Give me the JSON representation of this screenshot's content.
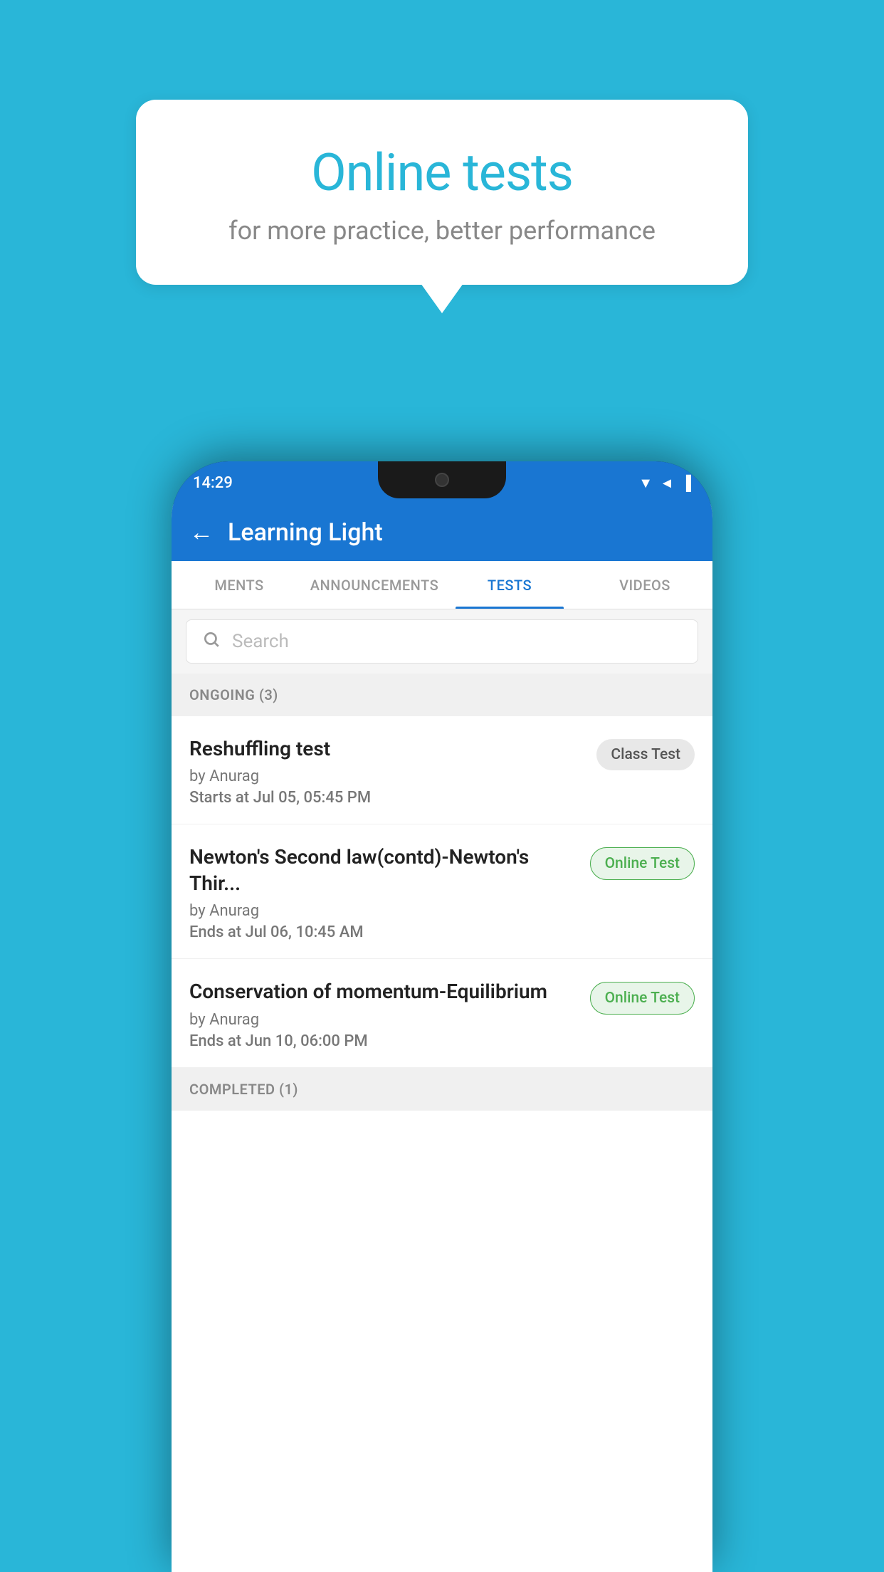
{
  "background": {
    "color": "#29b6d8"
  },
  "speech_bubble": {
    "title": "Online tests",
    "subtitle": "for more practice, better performance"
  },
  "phone": {
    "status_bar": {
      "time": "14:29",
      "icons": "▼◄▐"
    },
    "app_bar": {
      "back_label": "←",
      "title": "Learning Light"
    },
    "tabs": [
      {
        "label": "MENTS",
        "active": false
      },
      {
        "label": "ANNOUNCEMENTS",
        "active": false
      },
      {
        "label": "TESTS",
        "active": true
      },
      {
        "label": "VIDEOS",
        "active": false
      }
    ],
    "search": {
      "placeholder": "Search"
    },
    "ongoing_section": {
      "header": "ONGOING (3)",
      "items": [
        {
          "title": "Reshuffling test",
          "by": "by Anurag",
          "time_label": "Starts at",
          "time_value": "Jul 05, 05:45 PM",
          "badge": "Class Test",
          "badge_type": "class"
        },
        {
          "title": "Newton's Second law(contd)-Newton's Thir...",
          "by": "by Anurag",
          "time_label": "Ends at",
          "time_value": "Jul 06, 10:45 AM",
          "badge": "Online Test",
          "badge_type": "online"
        },
        {
          "title": "Conservation of momentum-Equilibrium",
          "by": "by Anurag",
          "time_label": "Ends at",
          "time_value": "Jun 10, 06:00 PM",
          "badge": "Online Test",
          "badge_type": "online"
        }
      ]
    },
    "completed_section": {
      "header": "COMPLETED (1)"
    }
  }
}
